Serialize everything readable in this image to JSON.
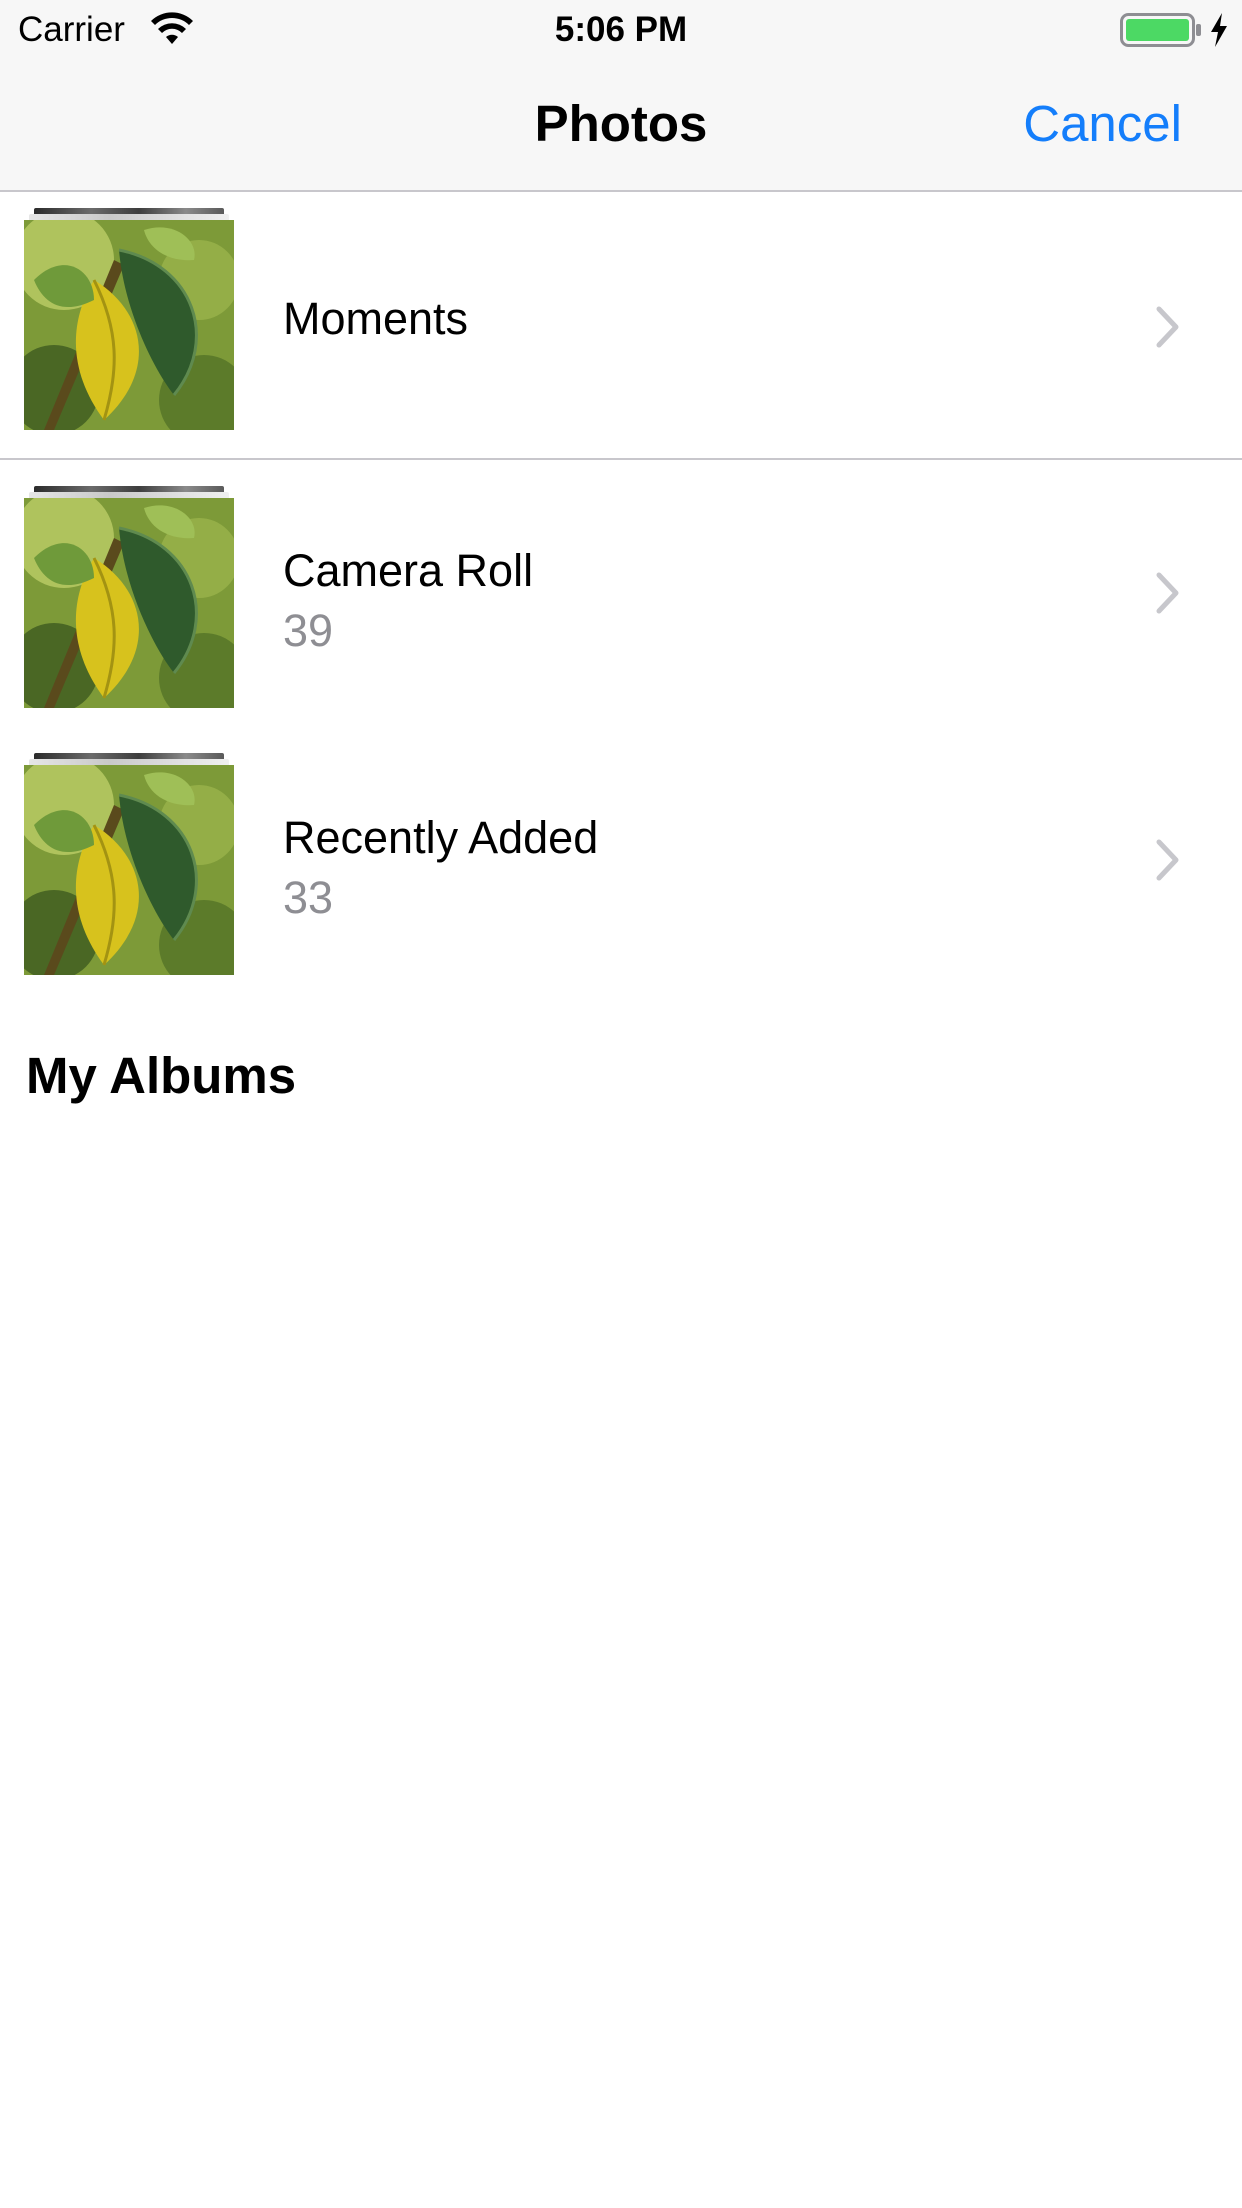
{
  "status_bar": {
    "carrier": "Carrier",
    "time": "5:06 PM",
    "battery_color": "#4cd964"
  },
  "nav_bar": {
    "title": "Photos",
    "cancel_label": "Cancel",
    "accent_color": "#147efb"
  },
  "albums": [
    {
      "title": "Moments",
      "count": "",
      "thumbnail": "leaf-photo"
    },
    {
      "title": "Camera Roll",
      "count": "39",
      "thumbnail": "leaf-photo"
    },
    {
      "title": "Recently Added",
      "count": "33",
      "thumbnail": "leaf-photo"
    }
  ],
  "sections": {
    "my_albums_header": "My Albums"
  },
  "icons": {
    "wifi": "wifi-icon",
    "battery": "battery-icon",
    "charging": "charging-bolt-icon",
    "chevron": "chevron-right-icon"
  }
}
